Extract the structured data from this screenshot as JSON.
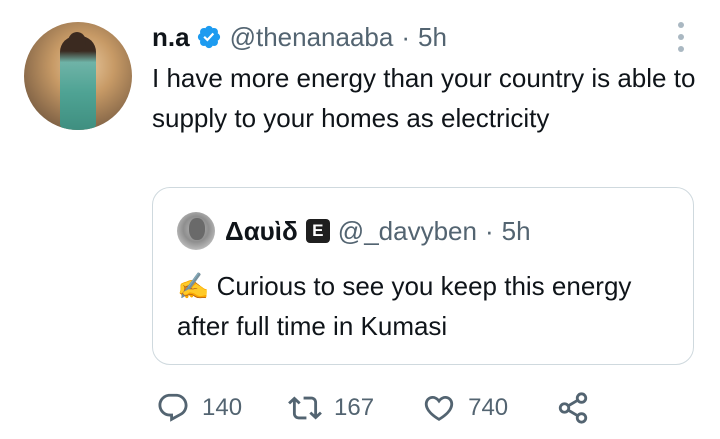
{
  "tweet": {
    "display_name": "n.a",
    "handle": "@thenanaaba",
    "separator": "·",
    "time": "5h",
    "text": "I have more energy than your country is able to supply to your homes as electricity",
    "verified_color": "#1d9bf0"
  },
  "quoted": {
    "display_name": "Δαυὶδ",
    "badge": "E",
    "handle": "@_davyben",
    "separator": "·",
    "time": "5h",
    "emoji": "✍️",
    "text": "Curious to see you keep this energy after full time in Kumasi"
  },
  "actions": {
    "replies": "140",
    "retweets": "167",
    "likes": "740"
  },
  "colors": {
    "text": "#0f1419",
    "muted": "#536471",
    "border": "#cfd9de"
  }
}
